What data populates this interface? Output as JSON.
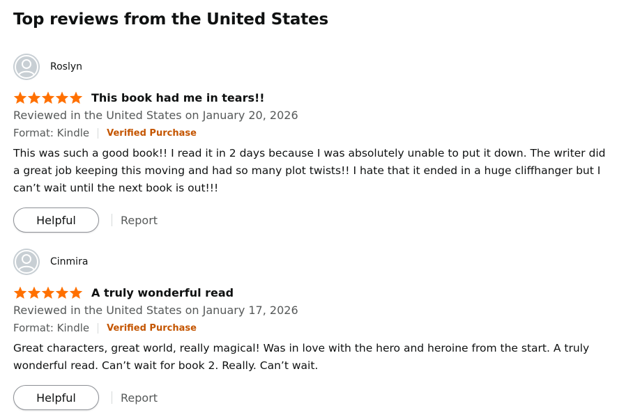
{
  "heading": "Top reviews from the United States",
  "colors": {
    "star": "#ff7000",
    "verified": "#c45500",
    "meta": "#565959",
    "text": "#0f1111"
  },
  "reviews": [
    {
      "profile_name": "Roslyn",
      "rating": 5,
      "max_rating": 5,
      "title": "This book had me in tears!!",
      "date_line": "Reviewed in the United States on January 20, 2026",
      "format": "Format: Kindle",
      "verified": "Verified Purchase",
      "body": "This was such a good book!! I read it in 2 days because I was absolutely unable to put it down. The writer did a great job keeping this moving and had so many plot twists!! I hate that it ended in a huge cliffhanger but I can’t wait until the next book is out!!!",
      "helpful_label": "Helpful",
      "report_label": "Report",
      "avatar_icon": "user-avatar-icon",
      "star_icon": "star-icon"
    },
    {
      "profile_name": "Cinmira",
      "rating": 5,
      "max_rating": 5,
      "title": "A truly wonderful read",
      "date_line": "Reviewed in the United States on January 17, 2026",
      "format": "Format: Kindle",
      "verified": "Verified Purchase",
      "body": "Great characters, great world, really magical! Was in love with the hero and heroine from the start. A truly wonderful read. Can’t wait for book 2. Really. Can’t wait.",
      "helpful_label": "Helpful",
      "report_label": "Report",
      "avatar_icon": "user-avatar-icon",
      "star_icon": "star-icon"
    }
  ]
}
